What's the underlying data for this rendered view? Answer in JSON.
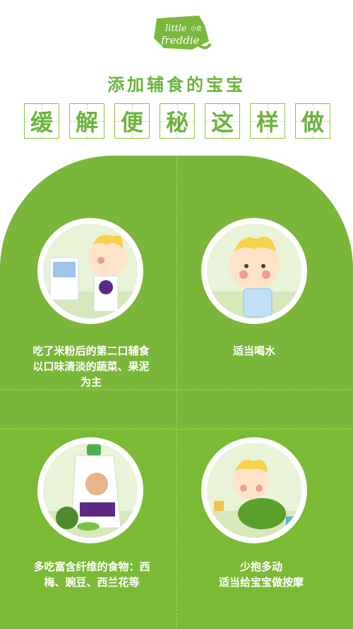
{
  "brand": {
    "logo_line1": "little",
    "logo_line2": "freddie",
    "logo_mark": "小皮"
  },
  "subtitle": "添加辅食的宝宝",
  "title_chars": [
    "缓",
    "解",
    "便",
    "秘",
    "这",
    "样",
    "做"
  ],
  "tips": [
    {
      "text_lines": [
        "吃了米粉后的第二口辅食",
        "以口味清淡的蔬菜、果泥",
        "为主"
      ],
      "icon": "baby-with-cereal-box"
    },
    {
      "text_lines": [
        "适当喝水"
      ],
      "icon": "baby-drinking-water"
    },
    {
      "text_lines": [
        "多吃富含纤维的食物：西",
        "梅、豌豆、西兰花等"
      ],
      "icon": "fruit-pouch-broccoli-peas"
    },
    {
      "heading": "少抱多动",
      "text_lines": [
        "适当给宝宝做按摩"
      ],
      "icon": "crawling-baby"
    }
  ],
  "colors": {
    "green": "#79b63a",
    "title_green": "#6cb33f",
    "white": "#ffffff"
  }
}
